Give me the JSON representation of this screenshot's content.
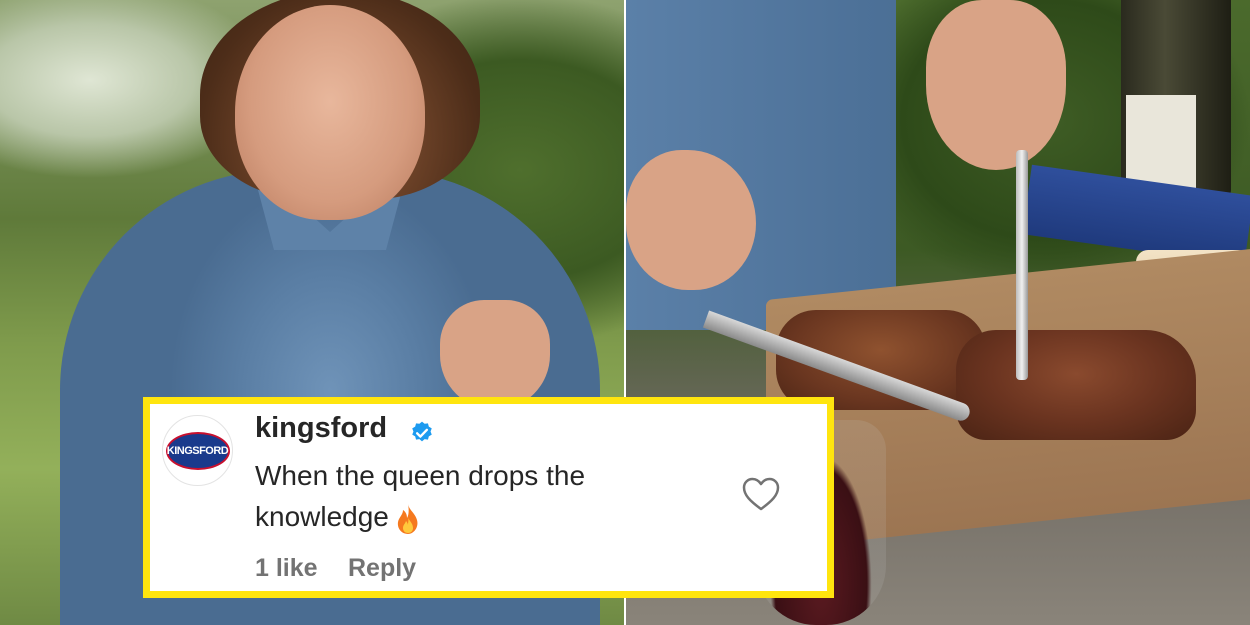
{
  "comment": {
    "username": "kingsford",
    "avatar_logo_text": "KINGSFORD",
    "text": "When the queen drops the knowledge",
    "emoji": "fire-icon",
    "likes_label": "1 like",
    "reply_label": "Reply",
    "icons": {
      "verified": "verified-badge-icon",
      "like": "heart-icon"
    }
  },
  "colors": {
    "highlight_border": "#ffe50e",
    "verified_blue": "#1d9bf0",
    "text_primary": "#262626",
    "text_secondary": "#737373"
  }
}
